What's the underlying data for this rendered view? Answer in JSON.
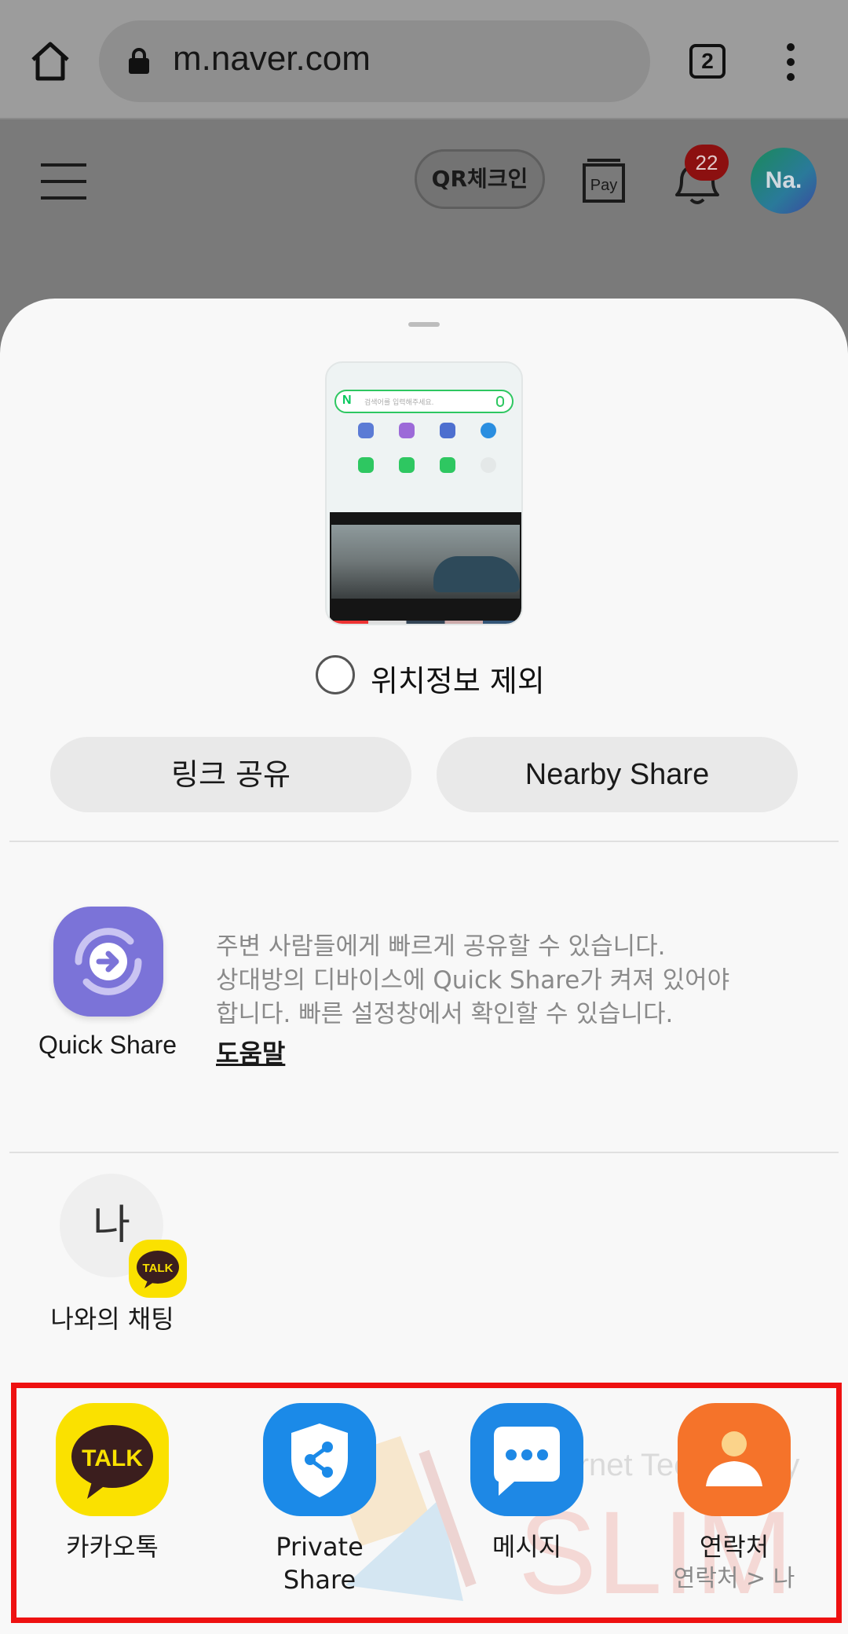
{
  "browser": {
    "url": "m.naver.com",
    "tab_count": "2"
  },
  "naver_header": {
    "qr_checkin": "QR체크인",
    "pay_label": "Pay",
    "notification_count": "22",
    "avatar_text": "Na."
  },
  "share_sheet": {
    "preview": {
      "search_placeholder": "검색어를 입력해주세요."
    },
    "exclude_location": {
      "label": "위치정보 제외",
      "checked": false
    },
    "buttons": {
      "link_share": "링크 공유",
      "nearby_share": "Nearby Share"
    },
    "quick_share": {
      "label": "Quick Share",
      "description_lines": [
        "주변 사람들에게 빠르게 공유할 수 있습니다.",
        "상대방의 디바이스에 Quick Share가 켜져 있어야",
        "합니다. 빠른 설정창에서 확인할 수 있습니다."
      ],
      "help": "도움말",
      "icon_color": "#7b73d8"
    },
    "direct_share": {
      "avatar_char": "나",
      "badge_text": "TALK",
      "label": "나와의 채팅"
    },
    "apps": [
      {
        "label": "카카오톡",
        "icon": "kakaotalk-icon",
        "color": "#fae100",
        "sub": ""
      },
      {
        "label": "Private\nShare",
        "icon": "private-share-icon",
        "color": "#1b8ae8",
        "sub": ""
      },
      {
        "label": "메시지",
        "icon": "messages-icon",
        "color": "#1e88e5",
        "sub": ""
      },
      {
        "label": "연락처",
        "icon": "contacts-icon",
        "color": "#f5732a",
        "sub": "연락처 > 나"
      }
    ],
    "highlight_color": "#ee1111"
  }
}
